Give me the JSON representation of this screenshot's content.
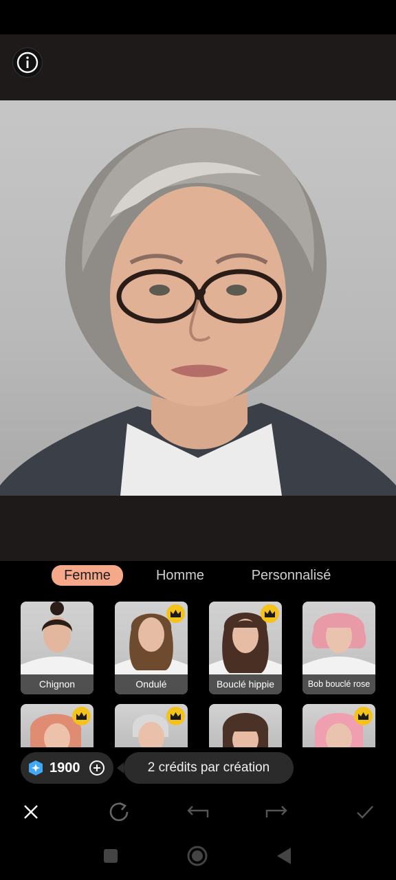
{
  "tabs": [
    {
      "label": "Femme",
      "active": true
    },
    {
      "label": "Homme",
      "active": false
    },
    {
      "label": "Personnalisé",
      "active": false
    }
  ],
  "styles": [
    {
      "label": "Chignon",
      "premium": false
    },
    {
      "label": "Ondulé",
      "premium": true
    },
    {
      "label": "Bouclé hippie",
      "premium": true
    },
    {
      "label": "Bob bouclé rose",
      "premium": false
    }
  ],
  "styles_row2": [
    {
      "premium": true
    },
    {
      "premium": true
    },
    {
      "premium": false
    },
    {
      "premium": true
    }
  ],
  "credits": {
    "value": "1900",
    "note": "2 crédits par création"
  },
  "colors": {
    "accent_tab": "#f5a98a",
    "crown": "#f4c21b",
    "gem": "#3fa9f5"
  },
  "icons": {
    "info": "info-icon",
    "close": "close-icon",
    "redo_generate": "refresh-icon",
    "undo": "undo-icon",
    "redo": "redo-icon",
    "confirm": "check-icon",
    "crown": "crown-icon",
    "gem": "gem-icon",
    "add": "plus-circle-icon"
  }
}
